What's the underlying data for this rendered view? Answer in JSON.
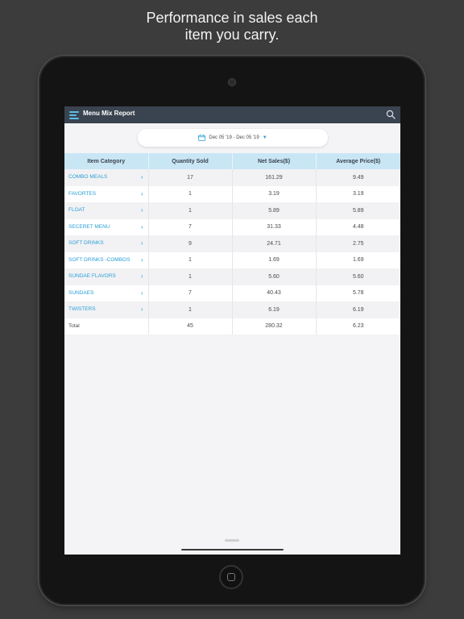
{
  "headline": {
    "line1": "Performance in sales each",
    "line2": "item you carry."
  },
  "app": {
    "title": "Menu Mix Report",
    "date_range": "Dec 05 '19 - Dec 05 '19",
    "accent_color": "#2a9fd6",
    "header_color": "#3a4350",
    "table_header_color": "#c9e6f5"
  },
  "icons": {
    "menu": "hamburger-menu-icon",
    "search": "search-icon",
    "calendar": "calendar-icon",
    "dropdown": "chevron-down-icon",
    "row": "chevron-right-icon"
  },
  "table": {
    "columns": [
      "Item Category",
      "Quantity Sold",
      "Net Sales($)",
      "Average Price($)"
    ],
    "rows": [
      {
        "category": "COMBO MEALS",
        "qty": "17",
        "net": "161.29",
        "avg": "9.49"
      },
      {
        "category": "FAVORTES",
        "qty": "1",
        "net": "3.19",
        "avg": "3.19"
      },
      {
        "category": "FLOAT",
        "qty": "1",
        "net": "5.89",
        "avg": "5.89"
      },
      {
        "category": "SECERET MENU",
        "qty": "7",
        "net": "31.33",
        "avg": "4.48"
      },
      {
        "category": "SOFT DRINKS",
        "qty": "9",
        "net": "24.71",
        "avg": "2.75"
      },
      {
        "category": "SOFT DRINKS -COMBOS",
        "qty": "1",
        "net": "1.69",
        "avg": "1.69"
      },
      {
        "category": "SUNDAE FLAVORS",
        "qty": "1",
        "net": "5.60",
        "avg": "5.60"
      },
      {
        "category": "SUNDAES",
        "qty": "7",
        "net": "40.43",
        "avg": "5.78"
      },
      {
        "category": "TWISTERS",
        "qty": "1",
        "net": "6.19",
        "avg": "6.19"
      }
    ],
    "total": {
      "label": "Total",
      "qty": "45",
      "net": "280.32",
      "avg": "6.23"
    }
  }
}
